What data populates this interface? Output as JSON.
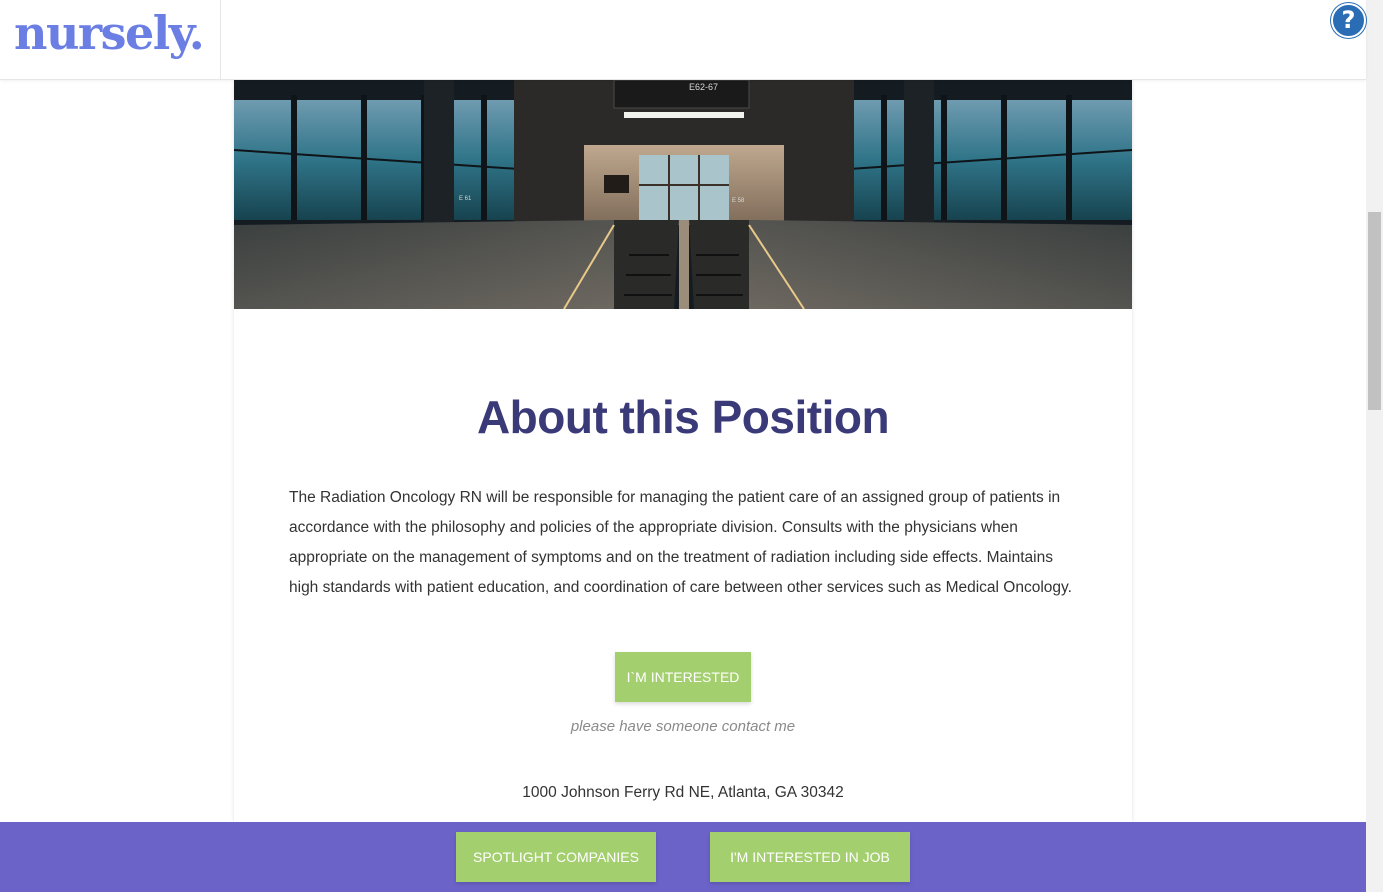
{
  "brand": {
    "logo_text": "nursely."
  },
  "help": {
    "icon": "question-circle-icon",
    "label": "?"
  },
  "hero": {
    "image": "airport-terminal-escalator-photo",
    "sign_text": "E62-67",
    "sign_text_2": "E 58",
    "sign_text_3": "E 61"
  },
  "position": {
    "title": "About this Position",
    "description": "The Radiation Oncology RN will be responsible for managing the patient care of an assigned group of patients in accordance with the philosophy and policies of the appropriate division. Consults with the physicians when appropriate on the management of symptoms and on the treatment of radiation including side effects. Maintains high standards with patient education, and coordination of care between other services such as Medical Oncology.",
    "interested_label": "I`M INTERESTED",
    "contact_note": "please have someone contact me",
    "address": "1000 Johnson Ferry Rd NE, Atlanta, GA 30342"
  },
  "footer": {
    "spotlight_label": "SPOTLIGHT COMPANIES",
    "interested_job_label": "I'M INTERESTED IN JOB"
  },
  "colors": {
    "brand": "#6a7ee4",
    "title": "#3a3a78",
    "button": "#a4cf6f",
    "footer": "#6c63c9",
    "help": "#2a6db5"
  }
}
